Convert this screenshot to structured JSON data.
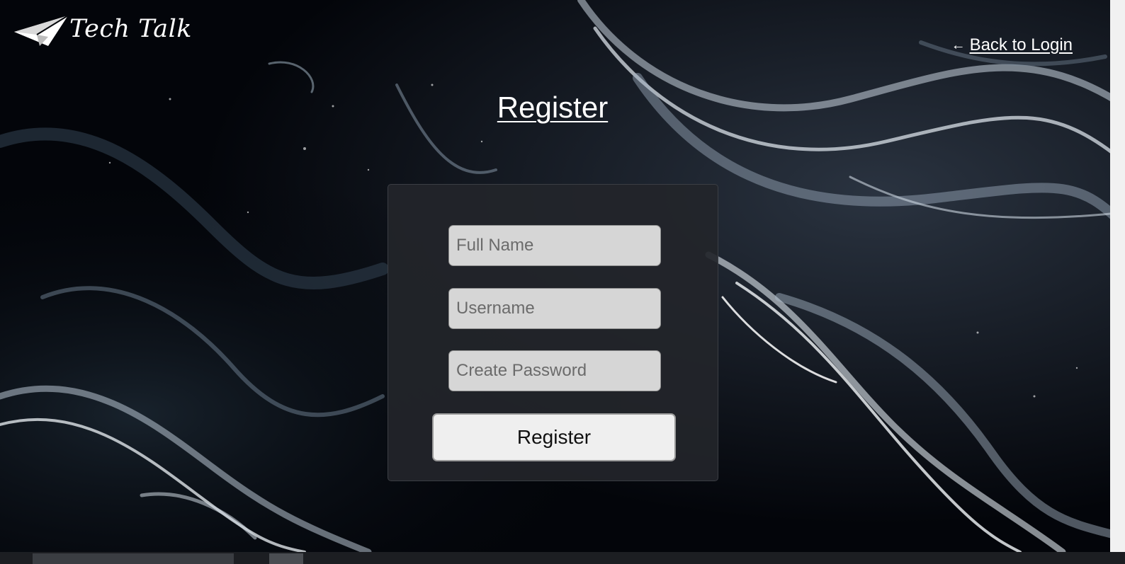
{
  "brand": {
    "name": "Tech Talk",
    "logo_icon": "paper-plane-icon"
  },
  "nav": {
    "back_arrow": "←",
    "back_label": "Back to Login",
    "back_icon": "arrow-left-icon"
  },
  "page": {
    "title": "Register"
  },
  "form": {
    "full_name": {
      "value": "",
      "placeholder": "Full Name"
    },
    "username": {
      "value": "",
      "placeholder": "Username"
    },
    "password": {
      "value": "",
      "placeholder": "Create Password"
    },
    "submit_label": "Register"
  },
  "colors": {
    "background": "#03050a",
    "card": "#23252a",
    "input": "#d6d6d6",
    "button": "#efefef",
    "text": "#ffffff"
  }
}
